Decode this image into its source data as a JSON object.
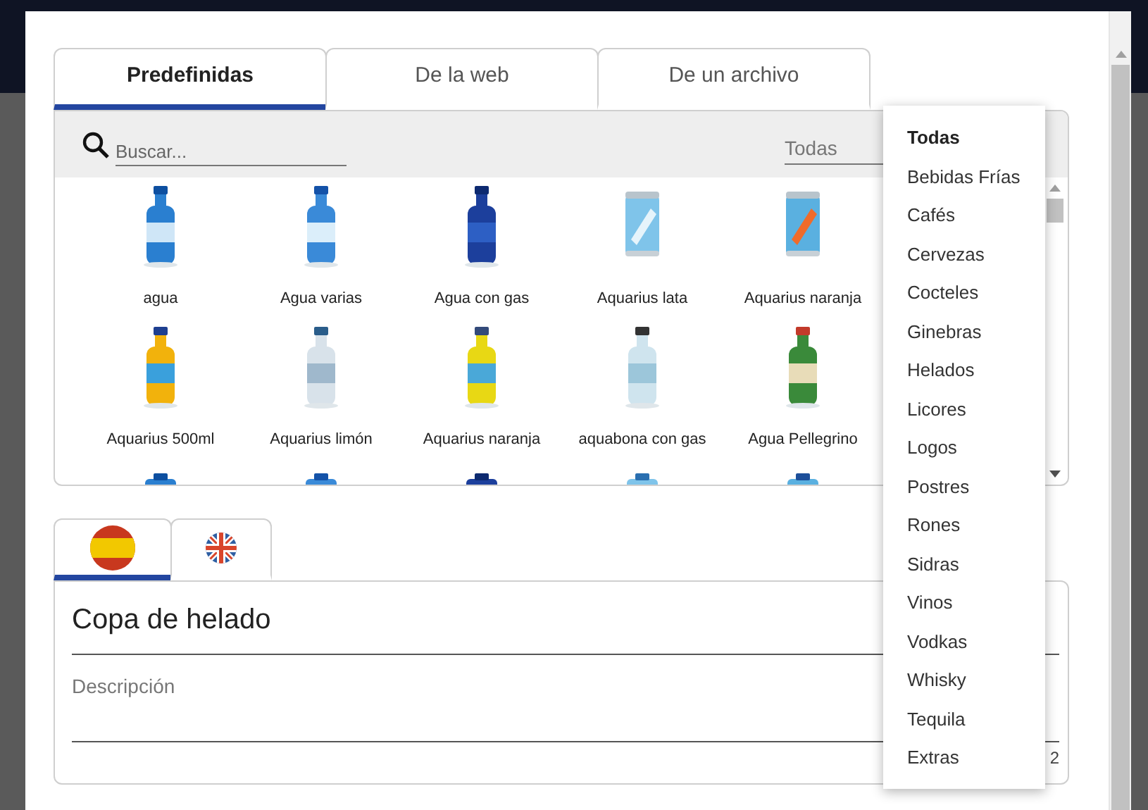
{
  "tabs": [
    {
      "label": "Predefinidas",
      "selected": true
    },
    {
      "label": "De la web",
      "selected": false
    },
    {
      "label": "De un archivo",
      "selected": false
    }
  ],
  "search": {
    "placeholder": "Buscar..."
  },
  "category_select": {
    "value": "Todas"
  },
  "products": [
    {
      "name": "agua"
    },
    {
      "name": "Agua varias"
    },
    {
      "name": "Agua con gas"
    },
    {
      "name": "Aquarius lata"
    },
    {
      "name": "Aquarius naranja"
    },
    {
      "name": "Aquarius 500ml"
    },
    {
      "name": "Aquarius limón"
    },
    {
      "name": "Aquarius naranja"
    },
    {
      "name": "aquabona con gas"
    },
    {
      "name": "Agua Pellegrino"
    },
    {
      "kind": "picture"
    },
    {
      "kind": "picture"
    },
    {
      "kind": "picture"
    },
    {
      "kind": "picture"
    },
    {
      "kind": "picture"
    }
  ],
  "language_tabs": [
    {
      "kind": "spain",
      "selected": true
    },
    {
      "kind": "uk",
      "selected": false
    }
  ],
  "name_field": {
    "value": "Copa de helado"
  },
  "description_field": {
    "placeholder": "Descripción"
  },
  "char_counter": "2",
  "category_menu": [
    {
      "label": "Todas",
      "selected": true
    },
    {
      "label": "Bebidas Frías",
      "selected": false
    },
    {
      "label": "Cafés",
      "selected": false
    },
    {
      "label": "Cervezas",
      "selected": false
    },
    {
      "label": "Cocteles",
      "selected": false
    },
    {
      "label": "Ginebras",
      "selected": false
    },
    {
      "label": "Helados",
      "selected": false
    },
    {
      "label": "Licores",
      "selected": false
    },
    {
      "label": "Logos",
      "selected": false
    },
    {
      "label": "Postres",
      "selected": false
    },
    {
      "label": "Rones",
      "selected": false
    },
    {
      "label": "Sidras",
      "selected": false
    },
    {
      "label": "Vinos",
      "selected": false
    },
    {
      "label": "Vodkas",
      "selected": false
    },
    {
      "label": "Whisky",
      "selected": false
    },
    {
      "label": "Tequila",
      "selected": false
    },
    {
      "label": "Extras",
      "selected": false
    }
  ]
}
